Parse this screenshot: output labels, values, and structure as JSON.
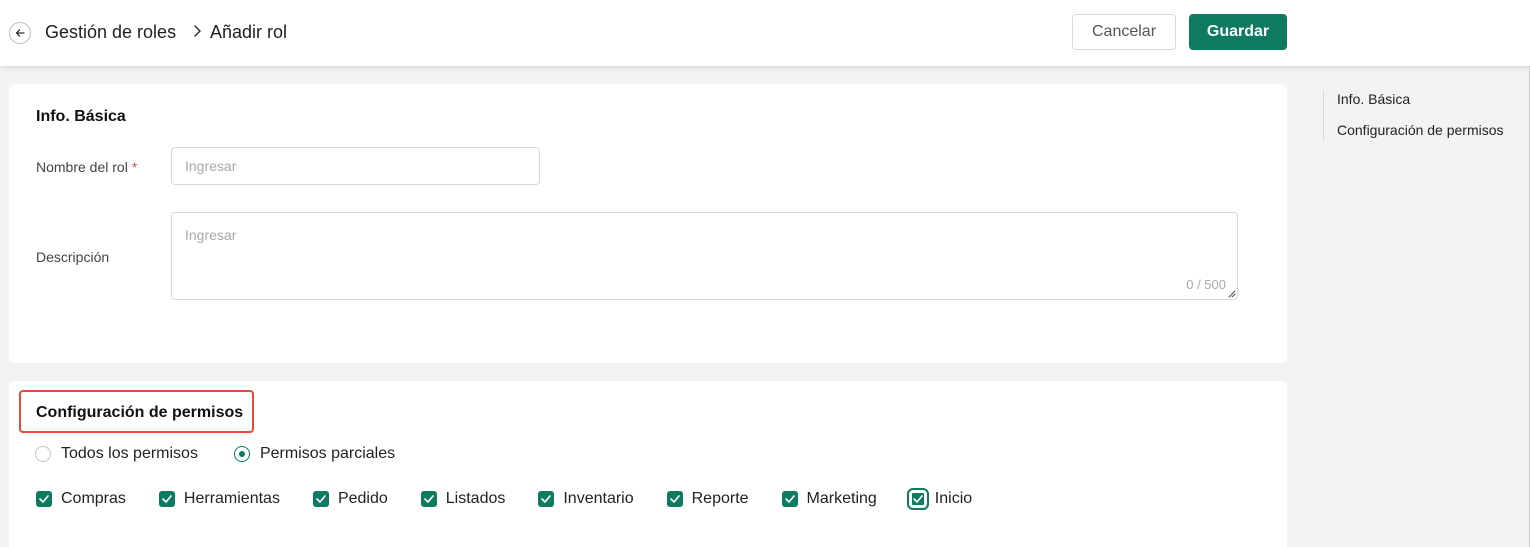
{
  "header": {
    "breadcrumb_parent": "Gestión de roles",
    "breadcrumb_current": "Añadir rol",
    "cancel_label": "Cancelar",
    "save_label": "Guardar"
  },
  "basic_info": {
    "title": "Info. Básica",
    "role_name_label": "Nombre del rol",
    "required_mark": "*",
    "role_name_placeholder": "Ingresar",
    "role_name_value": "",
    "description_label": "Descripción",
    "description_placeholder": "Ingresar",
    "description_value": "",
    "char_count": "0 / 500"
  },
  "permissions": {
    "title": "Configuración de permisos",
    "mode_options": [
      {
        "label": "Todos los permisos",
        "selected": false
      },
      {
        "label": "Permisos parciales",
        "selected": true
      }
    ],
    "modules": [
      {
        "label": "Compras",
        "checked": true
      },
      {
        "label": "Herramientas",
        "checked": true
      },
      {
        "label": "Pedido",
        "checked": true
      },
      {
        "label": "Listados",
        "checked": true
      },
      {
        "label": "Inventario",
        "checked": true
      },
      {
        "label": "Reporte",
        "checked": true
      },
      {
        "label": "Marketing",
        "checked": true
      },
      {
        "label": "Inicio",
        "checked": true
      }
    ]
  },
  "anchor_nav": {
    "items": [
      "Info. Básica",
      "Configuración de permisos"
    ]
  },
  "icons": {
    "back": "arrow-left-icon",
    "breadcrumb_separator": "chevron-right-icon",
    "checkbox": "check-icon",
    "resize": "resize-handle-icon"
  },
  "colors": {
    "primary": "#0e7a5f",
    "required": "#e5484d",
    "highlight_border": "#e5483d"
  }
}
